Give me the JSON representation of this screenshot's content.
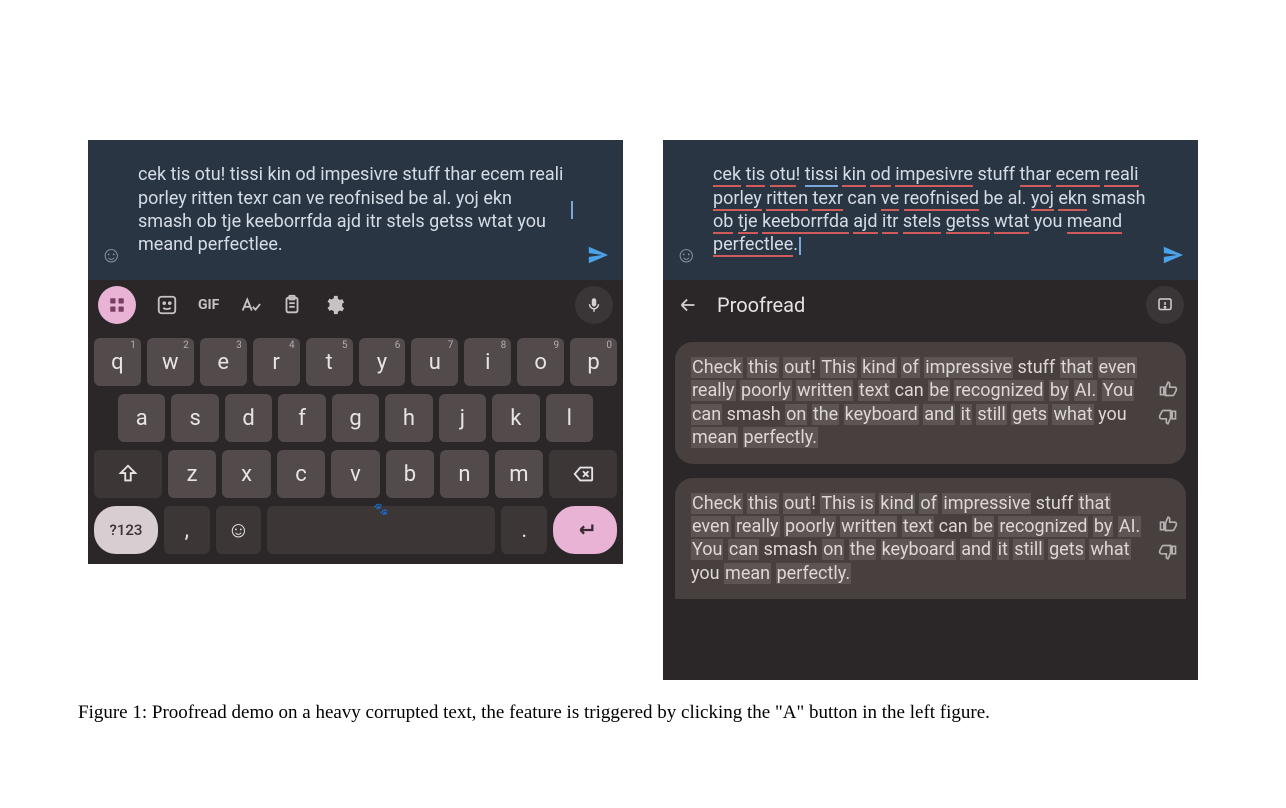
{
  "left_panel": {
    "typed_text": "cek tis otu! tissi kin od impesivre stuff thar ecem reali porley ritten texr can ve reofnised be al. yoj ekn smash ob tje keeborrfda ajd itr stels getss wtat you meand perfectlee.",
    "toolbar": {
      "gif_label": "GIF"
    },
    "keyboard": {
      "row1": [
        {
          "label": "q",
          "sup": "1"
        },
        {
          "label": "w",
          "sup": "2"
        },
        {
          "label": "e",
          "sup": "3"
        },
        {
          "label": "r",
          "sup": "4"
        },
        {
          "label": "t",
          "sup": "5"
        },
        {
          "label": "y",
          "sup": "6"
        },
        {
          "label": "u",
          "sup": "7"
        },
        {
          "label": "i",
          "sup": "8"
        },
        {
          "label": "o",
          "sup": "9"
        },
        {
          "label": "p",
          "sup": "0"
        }
      ],
      "row2": [
        "a",
        "s",
        "d",
        "f",
        "g",
        "h",
        "j",
        "k",
        "l"
      ],
      "row3": [
        "z",
        "x",
        "c",
        "v",
        "b",
        "n",
        "m"
      ],
      "numbers_label": "?123",
      "comma": ",",
      "period": "."
    }
  },
  "right_panel": {
    "typed_text": "cek tis otu! tissi kin od impesivre stuff thar ecem reali porley ritten texr can ve reofnised be al. yoj ekn smash ob tje keeborrfda ajd itr stels getss wtat you meand perfectlee.",
    "proofread_title": "Proofread",
    "suggestions": [
      "Check this out! This kind of impressive stuff that even really poorly written text can be recognized by AI. You can smash on the keyboard and it still gets what you mean perfectly.",
      "Check this out! This is kind of impressive stuff that even really poorly written text can be recognized by AI. You can smash on the keyboard and it still gets what you mean perfectly."
    ]
  },
  "caption": "Figure 1: Proofread demo on a heavy corrupted text, the feature is triggered by clicking the \"A\" button in the left figure."
}
